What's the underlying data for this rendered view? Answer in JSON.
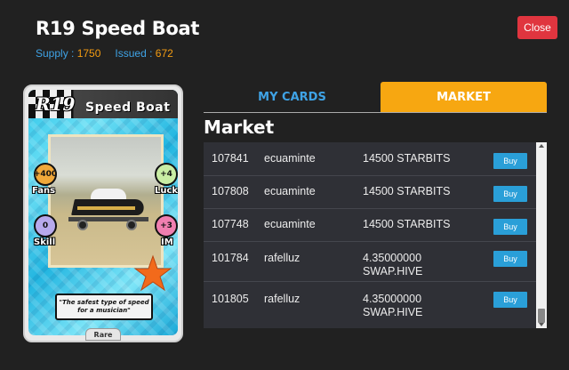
{
  "modal": {
    "title": "R19 Speed Boat",
    "supply_label": "Supply : ",
    "supply_value": "1750",
    "issued_label": "Issued : ",
    "issued_value": "672",
    "close_label": "Close"
  },
  "card": {
    "code": "R19",
    "type": "Speed Boat",
    "rarity": "Rare",
    "quote": "\"The safest type of speed for a musician\"",
    "stats": {
      "fans": {
        "label": "Fans",
        "value": "+400"
      },
      "luck": {
        "label": "Luck",
        "value": "+4"
      },
      "skill": {
        "label": "Skill",
        "value": "0"
      },
      "im": {
        "label": "IM",
        "value": "+3"
      }
    }
  },
  "tabs": [
    {
      "label": "MY CARDS",
      "active": false
    },
    {
      "label": "MARKET",
      "active": true
    }
  ],
  "market": {
    "title": "Market",
    "buy_label": "Buy",
    "rows": [
      {
        "id": "107841",
        "seller": "ecuaminte",
        "price": "14500 STARBITS"
      },
      {
        "id": "107808",
        "seller": "ecuaminte",
        "price": "14500 STARBITS"
      },
      {
        "id": "107748",
        "seller": "ecuaminte",
        "price": "14500 STARBITS"
      },
      {
        "id": "101784",
        "seller": "rafelluz",
        "price": "4.35000000 SWAP.HIVE"
      },
      {
        "id": "101805",
        "seller": "rafelluz",
        "price": "4.35000000 SWAP.HIVE"
      }
    ]
  },
  "colors": {
    "background": "#212121",
    "accent_blue": "#3fa3e6",
    "accent_orange": "#f7a711",
    "close_red": "#e0353f",
    "buy_blue": "#2a9fd8"
  }
}
